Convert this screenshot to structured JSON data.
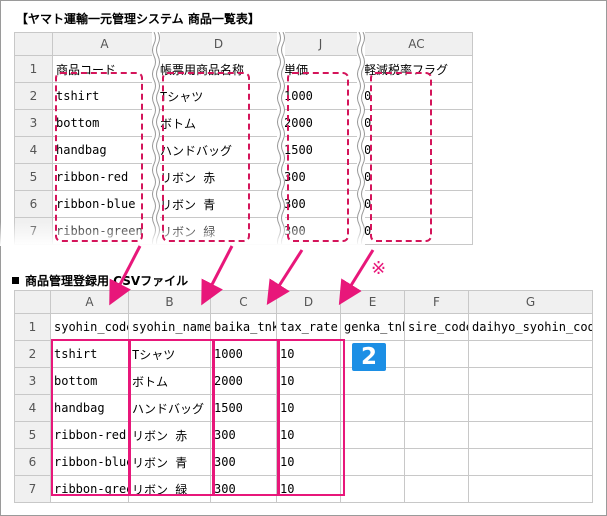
{
  "top_title": "【ヤマト運輸一元管理システム 商品一覧表】",
  "top_sheet": {
    "col_letters": [
      "A",
      "D",
      "J",
      "AC"
    ],
    "rows": [
      {
        "n": "1",
        "cells": [
          "商品コード",
          "帳票用商品名称",
          "単価",
          "軽減税率フラグ"
        ]
      },
      {
        "n": "2",
        "cells": [
          "tshirt",
          "Tシャツ",
          "1000",
          "0"
        ]
      },
      {
        "n": "3",
        "cells": [
          "bottom",
          "ボトム",
          "2000",
          "0"
        ]
      },
      {
        "n": "4",
        "cells": [
          "handbag",
          "ハンドバッグ",
          "1500",
          "0"
        ]
      },
      {
        "n": "5",
        "cells": [
          "ribbon-red",
          "リボン 赤",
          "300",
          "0"
        ]
      },
      {
        "n": "6",
        "cells": [
          "ribbon-blue",
          "リボン 青",
          "300",
          "0"
        ]
      },
      {
        "n": "7",
        "cells": [
          "ribbon-green",
          "リボン 緑",
          "300",
          "0"
        ]
      }
    ]
  },
  "bottom_title": "商品管理登録用 CSVファイル",
  "bottom_sheet": {
    "col_letters": [
      "A",
      "B",
      "C",
      "D",
      "E",
      "F",
      "G"
    ],
    "rows": [
      {
        "n": "1",
        "cells": [
          "syohin_code",
          "syohin_name",
          "baika_tnk",
          "tax_rate",
          "genka_tnk",
          "sire_code",
          "daihyo_syohin_code"
        ]
      },
      {
        "n": "2",
        "cells": [
          "tshirt",
          "Tシャツ",
          "1000",
          "10",
          "",
          "",
          ""
        ]
      },
      {
        "n": "3",
        "cells": [
          "bottom",
          "ボトム",
          "2000",
          "10",
          "",
          "",
          ""
        ]
      },
      {
        "n": "4",
        "cells": [
          "handbag",
          "ハンドバッグ",
          "1500",
          "10",
          "",
          "",
          ""
        ]
      },
      {
        "n": "5",
        "cells": [
          "ribbon-red",
          "リボン 赤",
          "300",
          "10",
          "",
          "",
          ""
        ]
      },
      {
        "n": "6",
        "cells": [
          "ribbon-blue",
          "リボン 青",
          "300",
          "10",
          "",
          "",
          ""
        ]
      },
      {
        "n": "7",
        "cells": [
          "ribbon-green",
          "リボン 緑",
          "300",
          "10",
          "",
          "",
          ""
        ]
      }
    ]
  },
  "badge_label": "2",
  "note_mark": "※",
  "colors": {
    "highlight": "#e8177a",
    "badge": "#1c8fe5"
  }
}
